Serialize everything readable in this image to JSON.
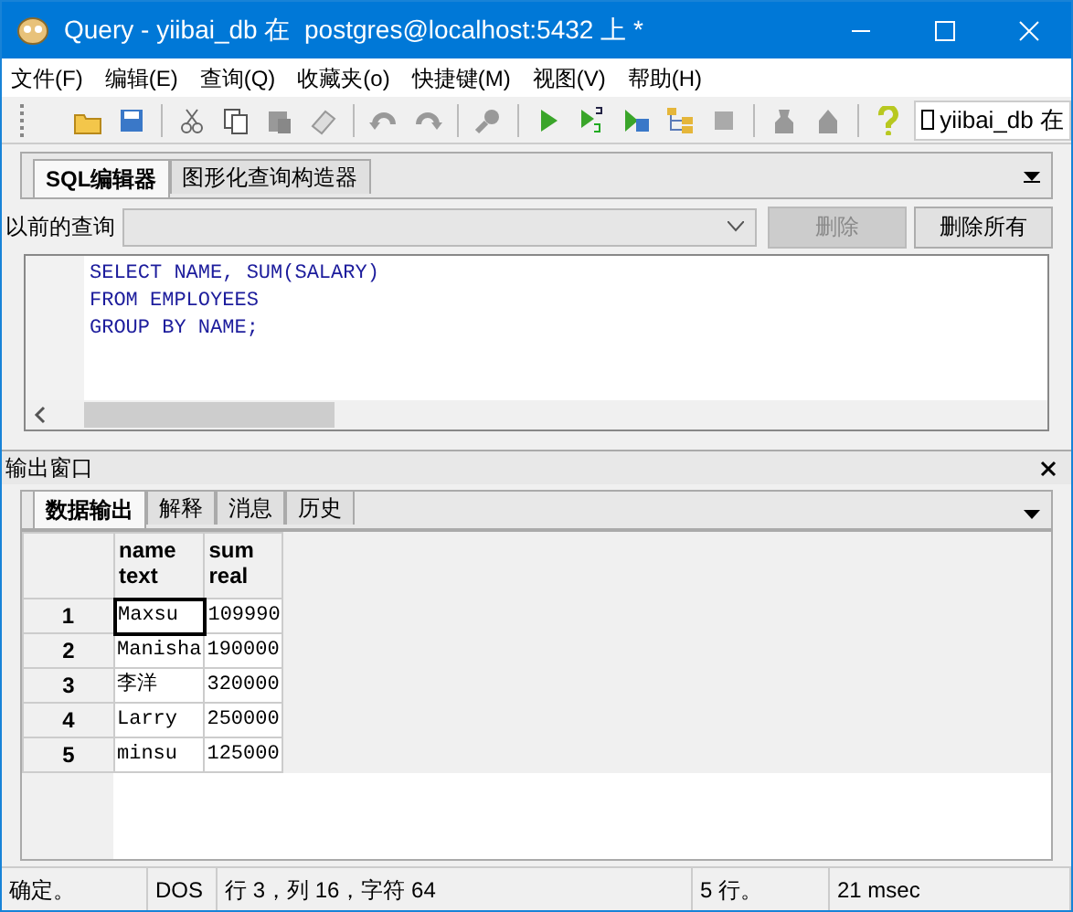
{
  "window": {
    "title": "Query - yiibai_db 在  postgres@localhost:5432 上 *"
  },
  "menu": [
    "文件(F)",
    "编辑(E)",
    "查询(Q)",
    "收藏夹(o)",
    "快捷键(M)",
    "视图(V)",
    "帮助(H)"
  ],
  "connection": {
    "label": "yiibai_db 在",
    "checked": false
  },
  "editor_tabs": [
    {
      "label": "SQL编辑器",
      "selected": true
    },
    {
      "label": "图形化查询构造器",
      "selected": false
    }
  ],
  "previous_queries": {
    "label": "以前的查询",
    "buttons": [
      {
        "label": "删除",
        "disabled": true
      },
      {
        "label": "删除所有",
        "disabled": false
      }
    ]
  },
  "sql": [
    "SELECT NAME, SUM(SALARY)",
    "FROM EMPLOYEES",
    "GROUP BY NAME;"
  ],
  "output": {
    "title": "输出窗口",
    "tabs": [
      {
        "label": "数据输出",
        "selected": true
      },
      {
        "label": "解释",
        "selected": false
      },
      {
        "label": "消息",
        "selected": false
      },
      {
        "label": "历史",
        "selected": false
      }
    ],
    "columns": [
      {
        "name": "name",
        "type": "text"
      },
      {
        "name": "sum",
        "type": "real"
      }
    ],
    "rows": [
      {
        "index": "1",
        "cells": [
          "Maxsu",
          "109990"
        ],
        "selected": true
      },
      {
        "index": "2",
        "cells": [
          "Manisha",
          "190000"
        ],
        "selected": false
      },
      {
        "index": "3",
        "cells": [
          "李洋",
          "320000"
        ],
        "selected": false
      },
      {
        "index": "4",
        "cells": [
          "Larry",
          "250000"
        ],
        "selected": false
      },
      {
        "index": "5",
        "cells": [
          "minsu",
          "125000"
        ],
        "selected": false
      }
    ]
  },
  "status_bar": [
    "确定。",
    "DOS",
    "行 3，列 16，字符 64",
    "5 行。",
    "21 msec"
  ]
}
